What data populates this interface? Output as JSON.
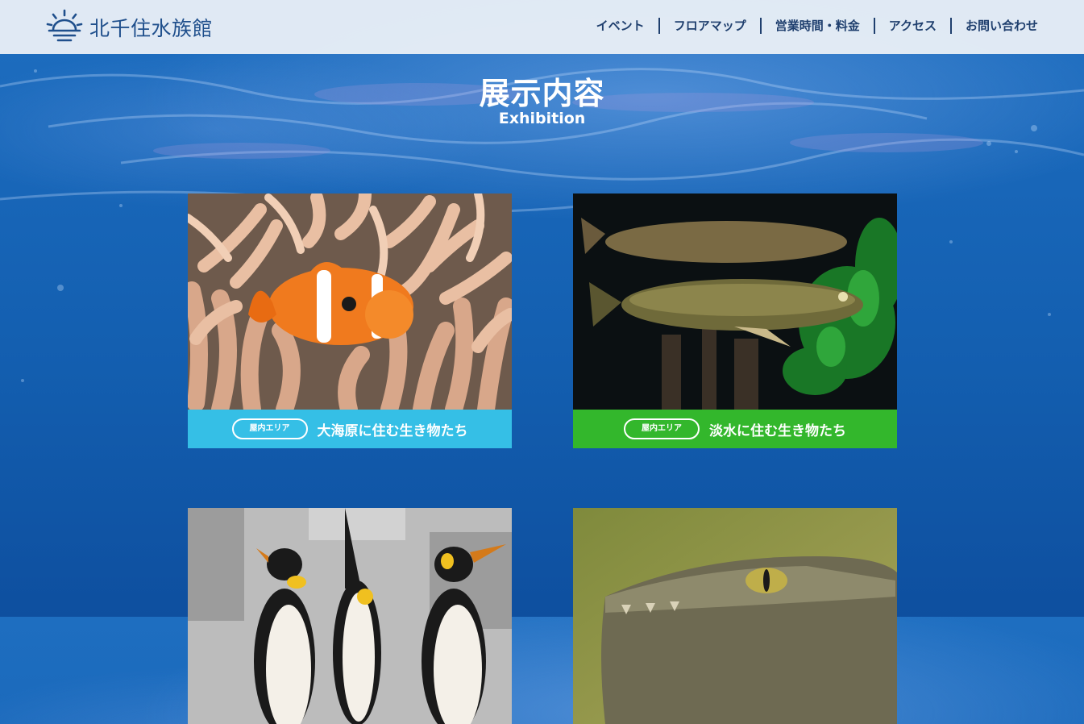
{
  "header": {
    "logo_text": "北千住水族館",
    "logo_icon": "sunrise-wave-icon",
    "nav": [
      {
        "label": "イベント"
      },
      {
        "label": "フロアマップ"
      },
      {
        "label": "営業時間・料金"
      },
      {
        "label": "アクセス"
      },
      {
        "label": "お問い合わせ"
      }
    ]
  },
  "section": {
    "title": "展示内容",
    "subtitle": "Exhibition"
  },
  "cards": [
    {
      "badge": "屋内エリア",
      "title": "大海原に住む生き物たち",
      "image": "clownfish-anemone-photo",
      "color": "#35bfe6"
    },
    {
      "badge": "屋内エリア",
      "title": "淡水に住む生き物たち",
      "image": "arowana-photo",
      "color": "#33b72c"
    },
    {
      "image": "king-penguins-photo"
    },
    {
      "image": "crocodile-photo"
    }
  ],
  "colors": {
    "header_bg": "#e8eef6",
    "nav_text": "#1f3f6e",
    "logo_text": "#1f4f8c",
    "ocean": "#1866b8"
  }
}
